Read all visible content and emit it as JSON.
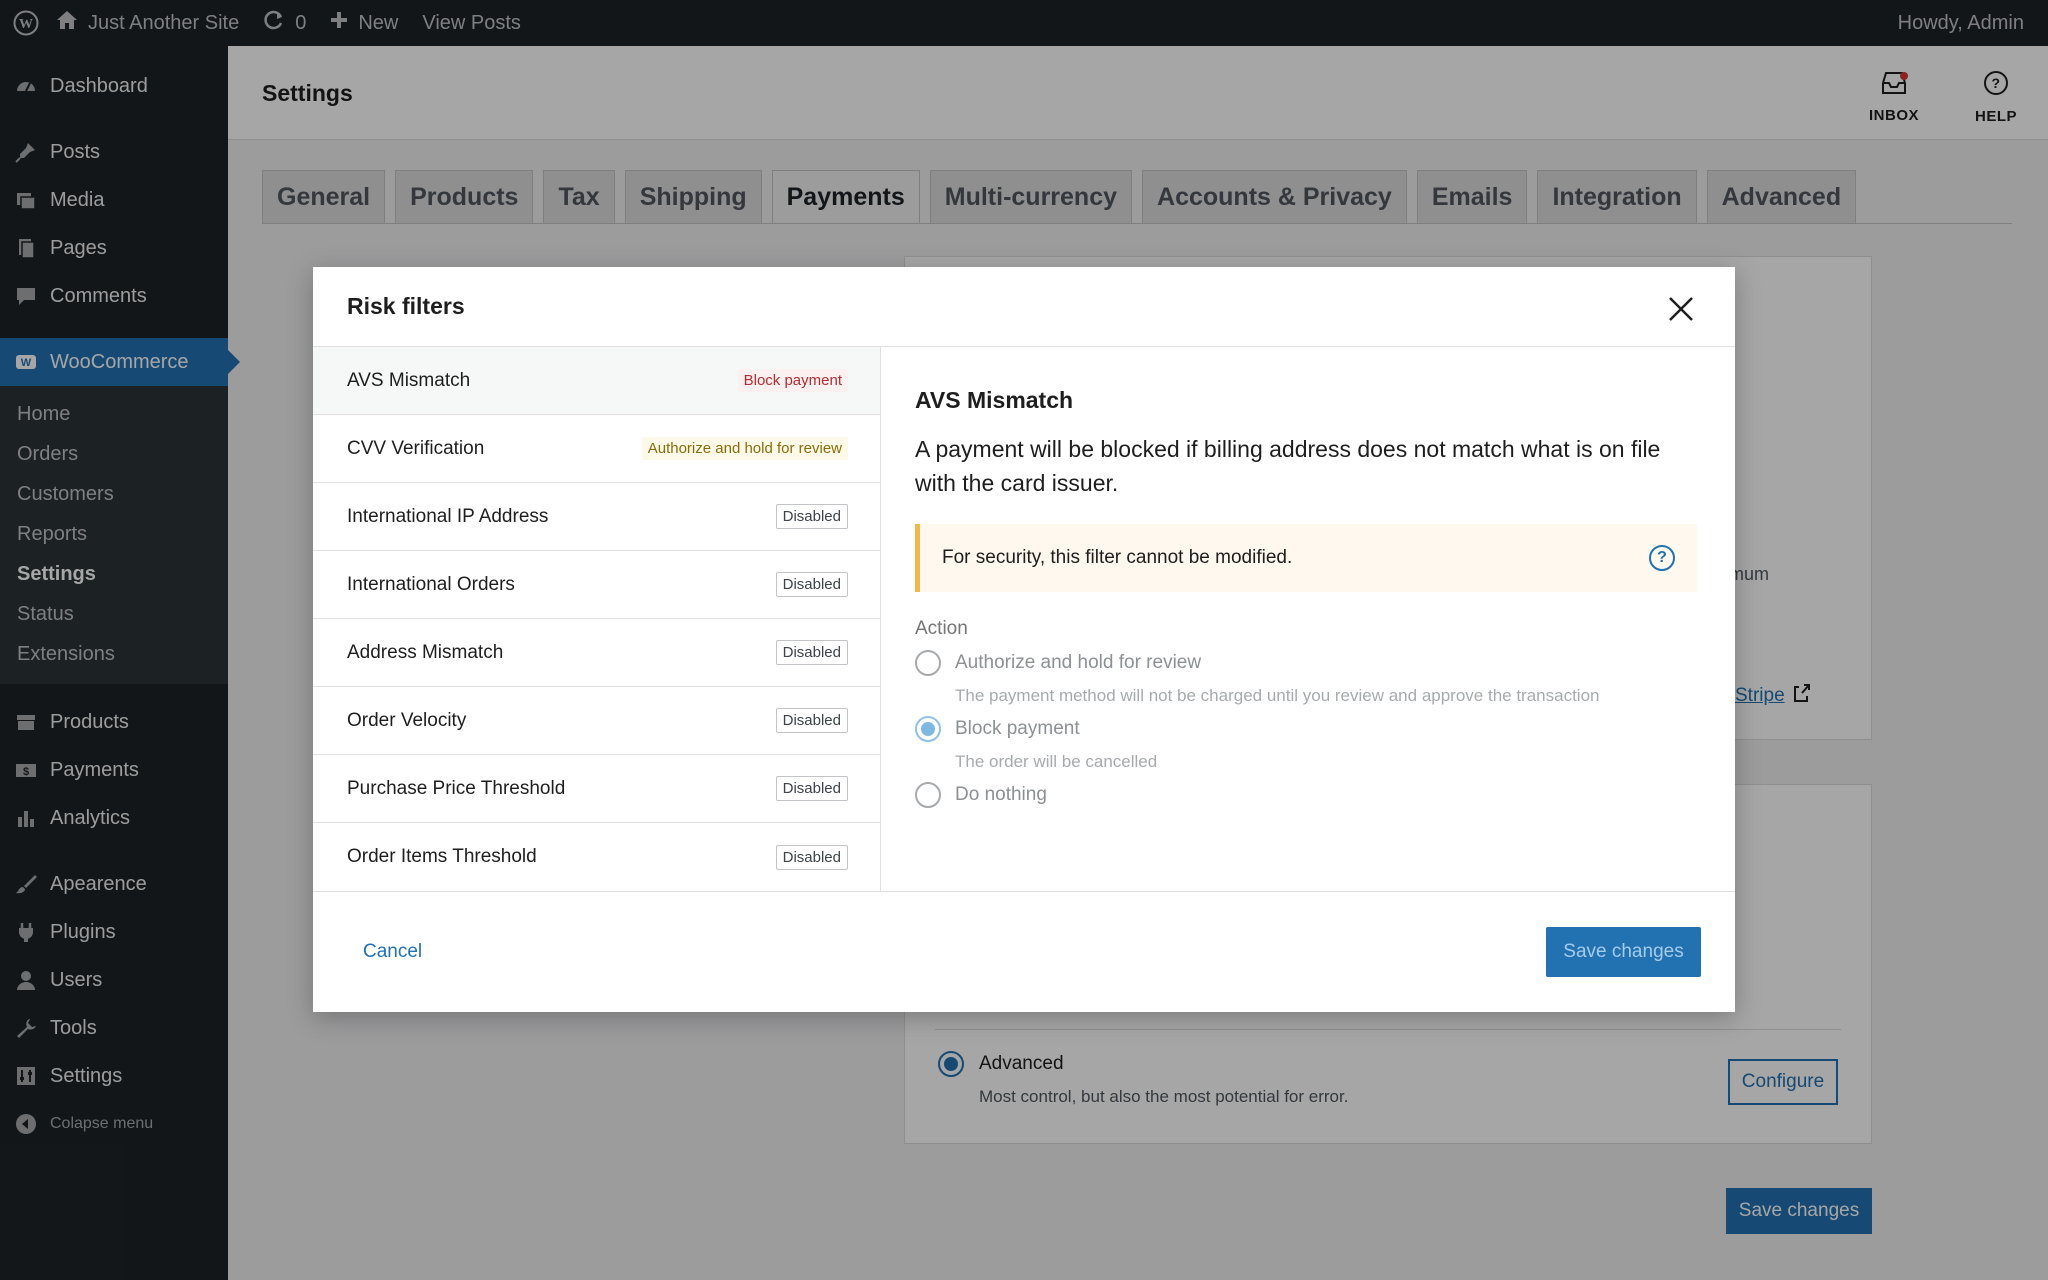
{
  "adminbar": {
    "site_name": "Just Another Site",
    "updates_count": "0",
    "new_label": "New",
    "view_posts": "View Posts",
    "howdy": "Howdy, Admin"
  },
  "sidebar": {
    "items_top": [
      {
        "label": "Dashboard",
        "icon": "dashboard-icon"
      },
      {
        "label": "Posts",
        "icon": "pin-icon"
      },
      {
        "label": "Media",
        "icon": "media-icon"
      },
      {
        "label": "Pages",
        "icon": "pages-icon"
      },
      {
        "label": "Comments",
        "icon": "comment-icon"
      }
    ],
    "woocommerce": "WooCommerce",
    "woo_sub": [
      "Home",
      "Orders",
      "Customers",
      "Reports",
      "Settings",
      "Status",
      "Extensions"
    ],
    "items_mid": [
      {
        "label": "Products",
        "icon": "archive-icon"
      },
      {
        "label": "Payments",
        "icon": "money-icon"
      },
      {
        "label": "Analytics",
        "icon": "chart-icon"
      }
    ],
    "items_bottom": [
      {
        "label": "Apearence",
        "icon": "brush-icon"
      },
      {
        "label": "Plugins",
        "icon": "plugin-icon"
      },
      {
        "label": "Users",
        "icon": "user-icon"
      },
      {
        "label": "Tools",
        "icon": "wrench-icon"
      },
      {
        "label": "Settings",
        "icon": "settings-icon"
      }
    ],
    "collapse": "Colapse menu"
  },
  "header": {
    "title": "Settings",
    "inbox": "INBOX",
    "help": "HELP"
  },
  "tabs": [
    "General",
    "Products",
    "Tax",
    "Shipping",
    "Payments",
    "Multi-currency",
    "Accounts & Privacy",
    "Emails",
    "Integration",
    "Advanced"
  ],
  "background": {
    "partial_text": "imum",
    "stripe_link": "Stripe",
    "advanced_label": "Advanced",
    "advanced_desc": "Most control, but also the most potential for error.",
    "configure": "Configure",
    "save_changes": "Save changes"
  },
  "modal": {
    "title": "Risk filters",
    "filters": [
      {
        "name": "AVS Mismatch",
        "status": "Block payment",
        "kind": "block"
      },
      {
        "name": "CVV Verification",
        "status": "Authorize and hold for review",
        "kind": "hold"
      },
      {
        "name": "International IP Address",
        "status": "Disabled",
        "kind": "disabled"
      },
      {
        "name": "International Orders",
        "status": "Disabled",
        "kind": "disabled"
      },
      {
        "name": "Address Mismatch",
        "status": "Disabled",
        "kind": "disabled"
      },
      {
        "name": "Order Velocity",
        "status": "Disabled",
        "kind": "disabled"
      },
      {
        "name": "Purchase Price Threshold",
        "status": "Disabled",
        "kind": "disabled"
      },
      {
        "name": "Order Items Threshold",
        "status": "Disabled",
        "kind": "disabled"
      }
    ],
    "detail": {
      "title": "AVS Mismatch",
      "description": "A payment will be blocked if billing address does not match what is on file with the card issuer.",
      "notice": "For security, this filter cannot be modified.",
      "action_label": "Action",
      "options": [
        {
          "label": "Authorize and hold for review",
          "hint": "The payment method will not be charged until you review and approve the transaction",
          "checked": false
        },
        {
          "label": "Block payment",
          "hint": "The order will be cancelled",
          "checked": true
        },
        {
          "label": "Do nothing",
          "hint": "",
          "checked": false
        }
      ]
    },
    "cancel": "Cancel",
    "save": "Save changes"
  },
  "colors": {
    "accent": "#2271b1",
    "sidebar_bg": "#1d2327",
    "block": "#b32d2e",
    "notice_border": "#f0b849"
  }
}
